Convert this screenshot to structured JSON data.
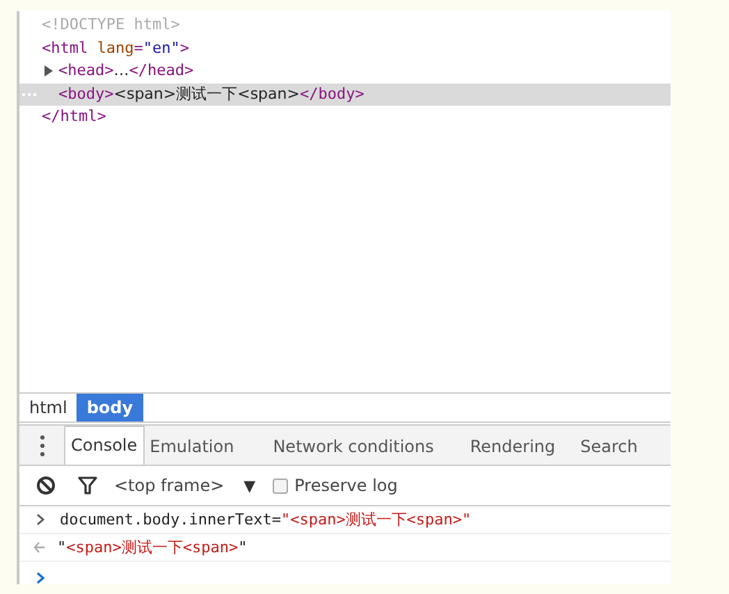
{
  "elements": {
    "nodes": [
      {
        "tokens": [
          {
            "kind": "doctype",
            "text": "<!DOCTYPE html>"
          }
        ],
        "selected": false
      },
      {
        "tokens": [
          {
            "kind": "tag",
            "text": "<html"
          },
          {
            "kind": "attr",
            "text": " lang"
          },
          {
            "kind": "tag",
            "text": "="
          },
          {
            "kind": "value",
            "text": "\"en\""
          },
          {
            "kind": "tag",
            "text": ">"
          }
        ],
        "selected": false,
        "children": [
          {
            "tokens": [
              {
                "kind": "tag",
                "text": "<head>"
              },
              {
                "kind": "text",
                "text": "…"
              },
              {
                "kind": "tag",
                "text": "</head>"
              }
            ],
            "selected": false,
            "expanded": false
          },
          {
            "tokens": [
              {
                "kind": "tag",
                "text": "<body>"
              },
              {
                "kind": "text",
                "text": "<span>测试一下<span>"
              },
              {
                "kind": "tag",
                "text": "</body>"
              }
            ],
            "selected": true
          }
        ],
        "close": [
          {
            "kind": "tag",
            "text": "</html>"
          }
        ]
      }
    ]
  },
  "breadcrumbs": [
    {
      "label": "html",
      "selected": false
    },
    {
      "label": "body",
      "selected": true
    }
  ],
  "drawer_tabs": [
    {
      "label": "Console",
      "selected": true
    },
    {
      "label": "Emulation",
      "selected": false
    },
    {
      "label": "Network conditions",
      "selected": false
    },
    {
      "label": "Rendering",
      "selected": false
    },
    {
      "label": "Search",
      "selected": false
    }
  ],
  "toolbar": {
    "frame_select": "<top frame>",
    "dropdown_arrow": "▼",
    "preserve_log": {
      "label": "Preserve log",
      "checked": false
    }
  },
  "console": [
    {
      "kind": "input",
      "tokens": [
        {
          "kind": "code",
          "text": "document.body.innerText="
        },
        {
          "kind": "string",
          "text": "\"<span>测试一下<span>\""
        }
      ]
    },
    {
      "kind": "result",
      "tokens": [
        {
          "kind": "code",
          "text": "\""
        },
        {
          "kind": "string",
          "text": "<span>测试一下<span>"
        },
        {
          "kind": "code",
          "text": "\""
        }
      ]
    }
  ]
}
